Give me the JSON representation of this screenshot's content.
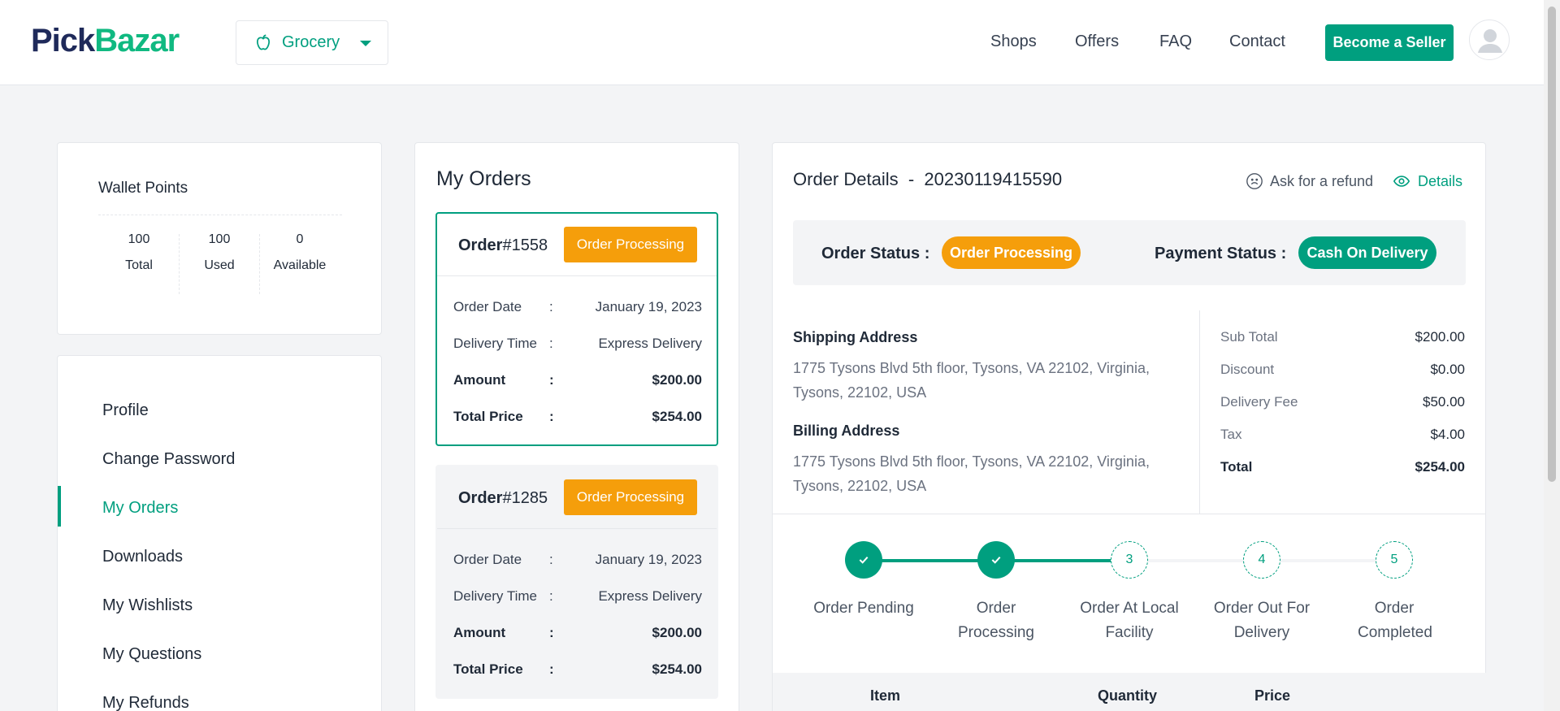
{
  "header": {
    "logo_part1": "Pick",
    "logo_part2": "Bazar",
    "shop_type": "Grocery",
    "nav": [
      "Shops",
      "Offers",
      "FAQ",
      "Contact"
    ],
    "seller_button": "Become a Seller"
  },
  "wallet": {
    "title": "Wallet Points",
    "stats": [
      {
        "value": "100",
        "label": "Total"
      },
      {
        "value": "100",
        "label": "Used"
      },
      {
        "value": "0",
        "label": "Available"
      }
    ]
  },
  "sidebar": {
    "items": [
      "Profile",
      "Change Password",
      "My Orders",
      "Downloads",
      "My Wishlists",
      "My Questions",
      "My Refunds"
    ],
    "active": "My Orders"
  },
  "orders": {
    "title": "My Orders",
    "list": [
      {
        "order_label": "Order",
        "number": "#1558",
        "status": "Order Processing",
        "rows": [
          {
            "label": "Order Date",
            "sep": ":",
            "value": "January 19, 2023"
          },
          {
            "label": "Delivery Time",
            "sep": ":",
            "value": "Express Delivery"
          },
          {
            "label": "Amount",
            "sep": ":",
            "value": "$200.00"
          },
          {
            "label": "Total Price",
            "sep": ":",
            "value": "$254.00"
          }
        ]
      },
      {
        "order_label": "Order",
        "number": "#1285",
        "status": "Order Processing",
        "rows": [
          {
            "label": "Order Date",
            "sep": ":",
            "value": "January 19, 2023"
          },
          {
            "label": "Delivery Time",
            "sep": ":",
            "value": "Express Delivery"
          },
          {
            "label": "Amount",
            "sep": ":",
            "value": "$200.00"
          },
          {
            "label": "Total Price",
            "sep": ":",
            "value": "$254.00"
          }
        ]
      }
    ]
  },
  "details": {
    "title": "Order Details",
    "title_sep": "-",
    "order_id": "20230119415590",
    "refund_link": "Ask for a refund",
    "details_link": "Details",
    "order_status_label": "Order Status :",
    "order_status": "Order Processing",
    "payment_status_label": "Payment Status :",
    "payment_status": "Cash On Delivery",
    "shipping_title": "Shipping Address",
    "shipping_address": "1775 Tysons Blvd 5th floor, Tysons, VA 22102, Virginia, Tysons, 22102, USA",
    "billing_title": "Billing Address",
    "billing_address": "1775 Tysons Blvd 5th floor, Tysons, VA 22102, Virginia, Tysons, 22102, USA",
    "summary": [
      {
        "label": "Sub Total",
        "value": "$200.00"
      },
      {
        "label": "Discount",
        "value": "$0.00"
      },
      {
        "label": "Delivery Fee",
        "value": "$50.00"
      },
      {
        "label": "Tax",
        "value": "$4.00"
      },
      {
        "label": "Total",
        "value": "$254.00"
      }
    ],
    "steps": [
      {
        "num": "1",
        "label": "Order Pending",
        "done": true
      },
      {
        "num": "2",
        "label": "Order Processing",
        "done": true
      },
      {
        "num": "3",
        "label": "Order At Local Facility",
        "done": false
      },
      {
        "num": "4",
        "label": "Order Out For Delivery",
        "done": false
      },
      {
        "num": "5",
        "label": "Order Completed",
        "done": false
      }
    ],
    "table_headers": [
      "Item",
      "Quantity",
      "Price"
    ]
  },
  "colors": {
    "accent": "#009f7f",
    "warning": "#f59e0b"
  }
}
